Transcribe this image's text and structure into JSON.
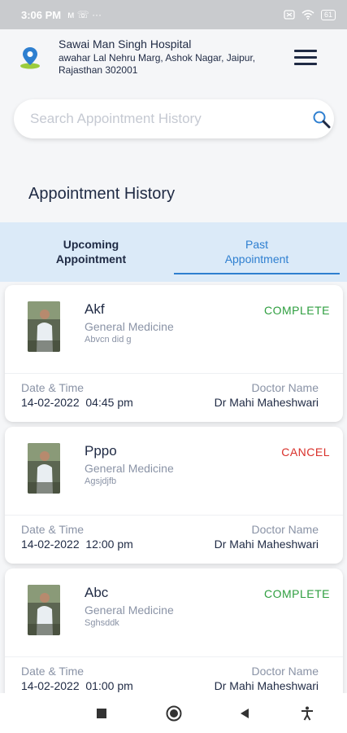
{
  "status_bar": {
    "time": "3:06 PM",
    "notification_icons": "ᴍ ☏ ···",
    "battery": "61"
  },
  "header": {
    "hospital_name": "Sawai Man Singh Hospital",
    "address": "awahar Lal Nehru Marg, Ashok Nagar, Jaipur, Rajasthan 302001",
    "location_icon": "location-pin-icon",
    "menu_icon": "hamburger-menu-icon"
  },
  "search": {
    "placeholder": "Search Appointment History",
    "value": "",
    "icon": "search-icon"
  },
  "page_title": "Appointment History",
  "tabs": [
    {
      "label": "Upcoming\nAppointment",
      "active": false
    },
    {
      "label": "Past\nAppointment",
      "active": true
    }
  ],
  "labels": {
    "date_time": "Date & Time",
    "doctor_name": "Doctor Name"
  },
  "colors": {
    "complete": "#2e9e3f",
    "cancel": "#d9302a",
    "accent": "#2e7fd0",
    "tab_bar_bg": "#dbeaf8"
  },
  "appointments": [
    {
      "patient": "Akf",
      "department": "General Medicine",
      "note": "Abvcn did g",
      "status": "COMPLETE",
      "datetime": "14-02-2022  04:45 pm",
      "doctor": "Dr Mahi Maheshwari"
    },
    {
      "patient": "Pppo",
      "department": "General Medicine",
      "note": "Agsjdjfb",
      "status": "CANCEL",
      "datetime": "14-02-2022  12:00 pm",
      "doctor": "Dr Mahi Maheshwari"
    },
    {
      "patient": "Abc",
      "department": "General Medicine",
      "note": "Sghsddk",
      "status": "COMPLETE",
      "datetime": "14-02-2022  01:00 pm",
      "doctor": "Dr Mahi Maheshwari"
    }
  ],
  "nav_bar": {
    "buttons": [
      "recents-square-icon",
      "home-circle-icon",
      "back-triangle-icon",
      "accessibility-icon"
    ]
  }
}
